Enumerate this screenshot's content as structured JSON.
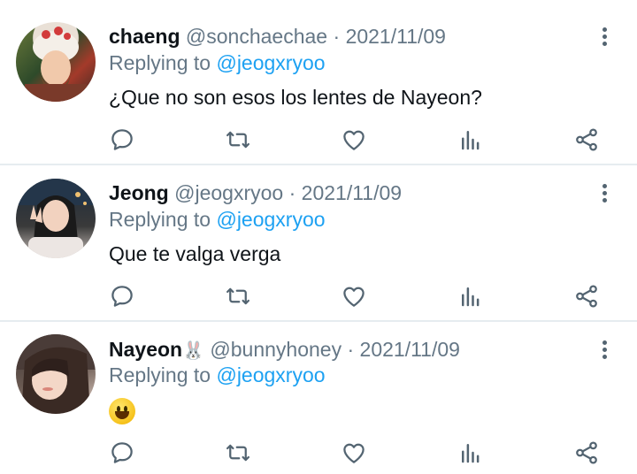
{
  "colors": {
    "mention": "#1da1f2",
    "muted": "#657786",
    "icon": "#536471",
    "divider": "#e6ecf0"
  },
  "tweets": [
    {
      "name": "chaeng",
      "handle": "@sonchaechae",
      "separator": "·",
      "date": "2021/11/09",
      "replying_prefix": "Replying to",
      "replying_to": "@jeogxryoo",
      "text": "¿Que no son esos los lentes de Nayeon?"
    },
    {
      "name": "Jeong",
      "handle": "@jeogxryoo",
      "separator": "·",
      "date": "2021/11/09",
      "replying_prefix": "Replying to",
      "replying_to": "@jeogxryoo",
      "text": "Que te valga verga"
    },
    {
      "name": "Nayeon",
      "name_emoji": "🐰",
      "handle": "@bunnyhoney",
      "separator": "·",
      "date": "2021/11/09",
      "replying_prefix": "Replying to",
      "replying_to": "@jeogxryoo",
      "text_emoji": "grinning-face-emoji"
    }
  ],
  "action_icons": [
    "reply-icon",
    "retweet-icon",
    "like-icon",
    "analytics-icon",
    "share-icon"
  ]
}
